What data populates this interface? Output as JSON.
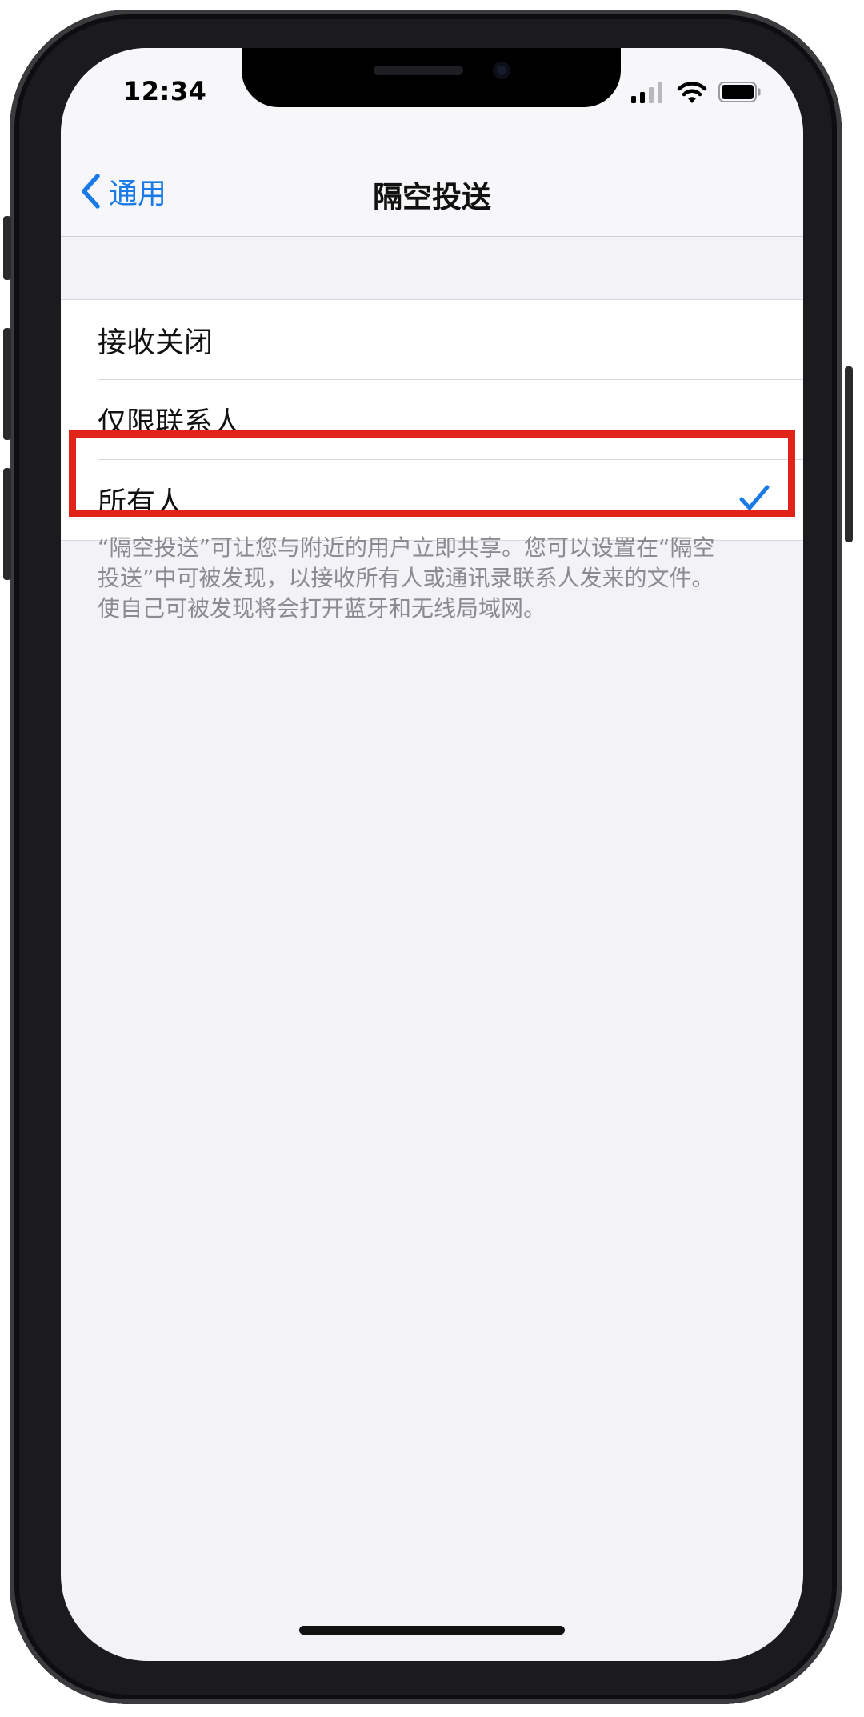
{
  "status_bar": {
    "time": "12:34"
  },
  "nav": {
    "back_label": "通用",
    "title": "隔空投送"
  },
  "options": [
    {
      "label": "接收关闭",
      "selected": false
    },
    {
      "label": "仅限联系人",
      "selected": false
    },
    {
      "label": "所有人",
      "selected": true
    }
  ],
  "footer": {
    "text": "“隔空投送”可让您与附近的用户立即共享。您可以设置在“隔空\n投送”中可被发现，以接收所有人或通讯录联系人发来的文件。\n使自己可被发现将会打开蓝牙和无线局域网。"
  },
  "colors": {
    "accent": "#1a7ae8",
    "highlight": "#e2231a"
  }
}
